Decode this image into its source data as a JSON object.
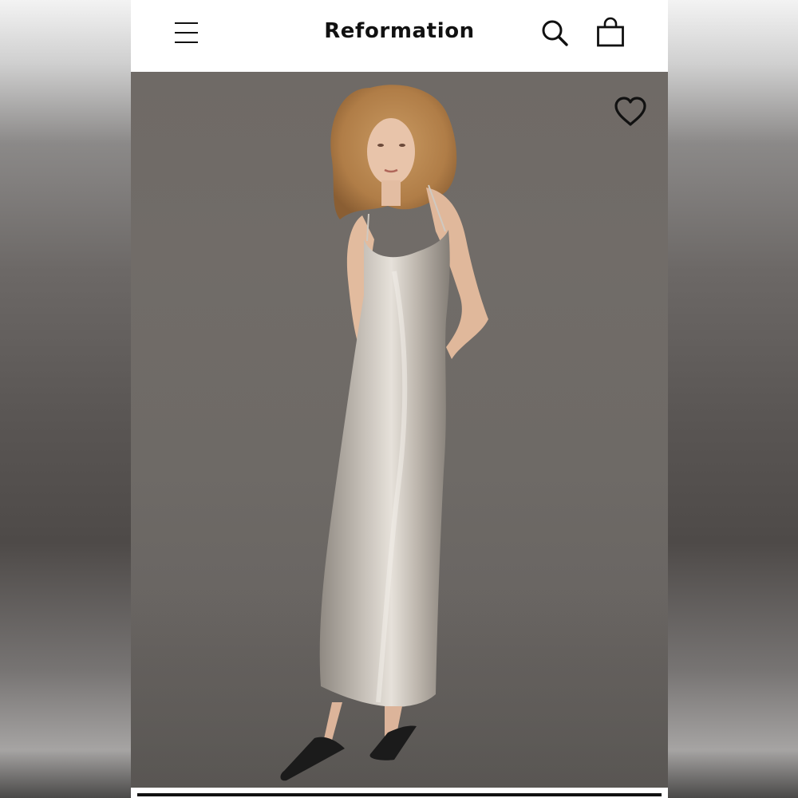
{
  "app": {
    "brand": "Reformation"
  },
  "header": {
    "menu_icon": "hamburger-menu-icon",
    "search_icon": "search-icon",
    "bag_icon": "shopping-bag-icon"
  },
  "hero": {
    "favorite_icon": "heart-outline-icon",
    "image_subject": "model-in-silver-slip-dress"
  },
  "colors": {
    "brand_text": "#111111",
    "header_bg": "#ffffff",
    "backdrop": "#6e6a66",
    "dress": "#b9b3ab"
  }
}
